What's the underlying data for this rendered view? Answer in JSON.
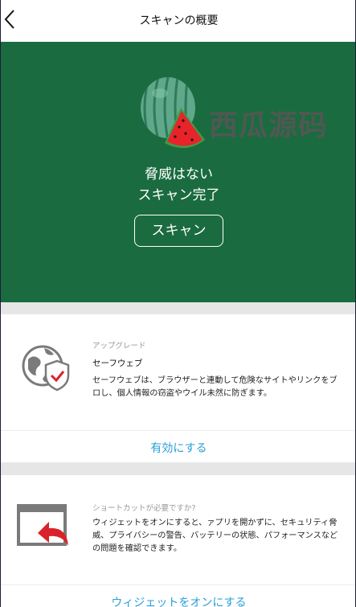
{
  "header": {
    "title": "スキャンの概要"
  },
  "hero": {
    "watermark": "西瓜源码",
    "status_line1": "脅威はない",
    "status_line2": "スキャン完了",
    "scan_button": "スキャン",
    "background_color": "#1a6b3f"
  },
  "card_safe_web": {
    "tag": "アップグレード",
    "title": "セーフウェブ",
    "description": "セーフウェブは、ブラウザーと連動して危険なサイトやリンクをブロし、個人情報の窃盗やウイル未然に防ぎます。",
    "action": "有効にする"
  },
  "card_widget": {
    "tag": "ショートカットが必要ですか?",
    "description": "ウィジェットをオンにすると、ァプリを開かずに、セキュリティ脅威、プライバシーの警告、バッテリーの状態、パフォーマンスなどの問題を確認できます。",
    "action": "ウィジェットをオンにする"
  },
  "colors": {
    "accent": "#2a9fd6",
    "hero_green": "#1a6b3f",
    "separator": "#e6e6e6"
  }
}
